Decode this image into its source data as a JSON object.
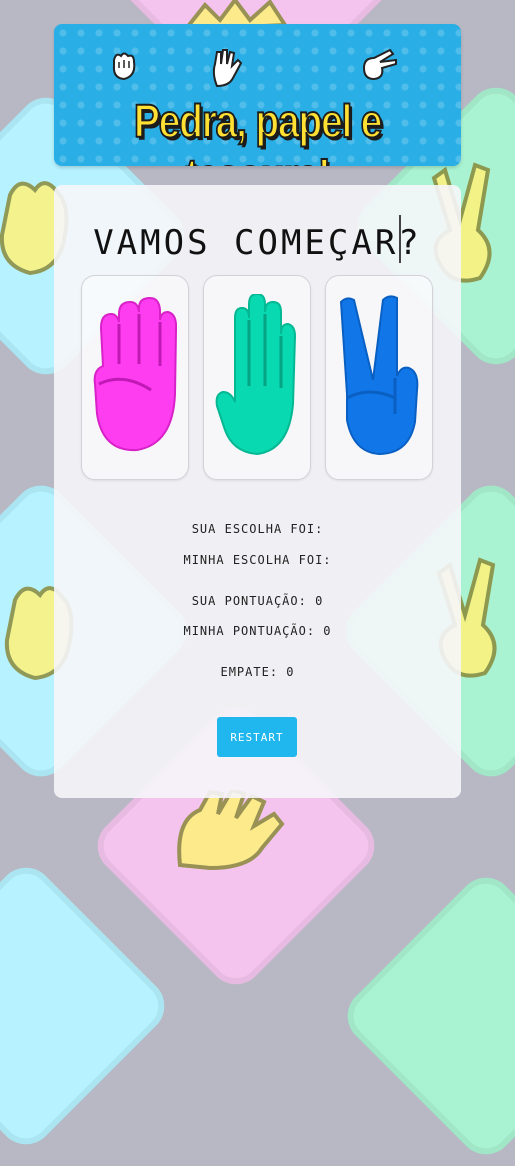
{
  "banner": {
    "title": "Pedra, papel e tesoura!",
    "icons": [
      "fist-icon",
      "open-hand-icon",
      "peace-hand-icon"
    ]
  },
  "game": {
    "heading": "VAMOS COMEÇAR?",
    "choices": [
      {
        "name": "rock",
        "icon": "rock-fist-icon",
        "color": "#ff3df0"
      },
      {
        "name": "paper",
        "icon": "paper-hand-icon",
        "color": "#08d9b0"
      },
      {
        "name": "scissors",
        "icon": "scissors-hand-icon",
        "color": "#1177e8"
      }
    ],
    "your_choice_label": "SUA ESCOLHA FOI:",
    "my_choice_label": "MINHA ESCOLHA FOI:",
    "your_score_label": "SUA PONTUAÇÃO: 0",
    "my_score_label": "MINHA PONTUAÇÃO: 0",
    "tie_label": "EMPATE: 0",
    "restart_label": "RESTART"
  },
  "colors": {
    "page_bg": "#b7b8c4",
    "banner_bg": "#2aaee6",
    "title_yellow": "#ffe033",
    "restart_bg": "#20b6ee"
  }
}
